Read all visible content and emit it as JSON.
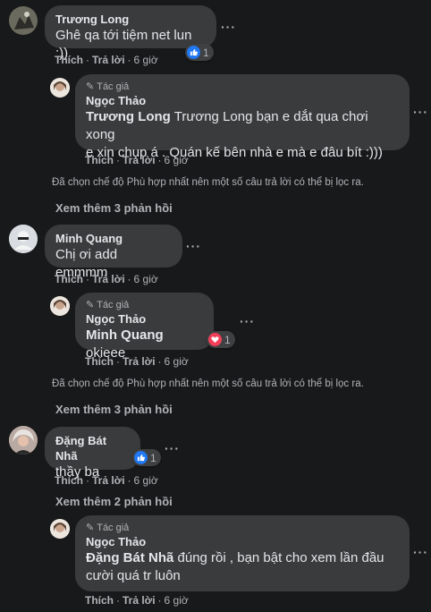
{
  "comments": [
    {
      "author": "Trương Long",
      "text": "Ghê qa tới tiệm net lun :))",
      "reaction_count": "1",
      "actions": {
        "like": "Thích",
        "reply": "Trả lời",
        "time": "6 giờ"
      },
      "reply": {
        "author_tag": "Tác giả",
        "author": "Ngọc Thảo",
        "mention": "Trương Long",
        "text_line1": " Trương Long bạn e dắt qua chơi xong",
        "text_line2": "e xin chụp á . Quán kế bên nhà e mà e đâu bít :)))",
        "actions": {
          "like": "Thích",
          "reply": "Trả lời",
          "time": "6 giờ"
        }
      },
      "filter_note": "Đã chọn chế độ Phù hợp nhất nên một số câu trả lời có thể bị lọc ra.",
      "see_more": "Xem thêm 3 phản hồi"
    },
    {
      "author": "Minh Quang",
      "text": "Chị ơi add emmmm",
      "actions": {
        "like": "Thích",
        "reply": "Trả lời",
        "time": "6 giờ"
      },
      "reply": {
        "author_tag": "Tác giả",
        "author": "Ngọc Thảo",
        "mention": "Minh Quang",
        "text": " okieee",
        "reaction_count": "1",
        "actions": {
          "like": "Thích",
          "reply": "Trả lời",
          "time": "6 giờ"
        }
      },
      "filter_note": "Đã chọn chế độ Phù hợp nhất nên một số câu trả lời có thể bị lọc ra.",
      "see_more": "Xem thêm 3 phản hồi"
    },
    {
      "author": "Đặng Bát Nhã",
      "text": "thầy ba",
      "reaction_count": "1",
      "actions": {
        "like": "Thích",
        "reply": "Trả lời",
        "time": "6 giờ"
      },
      "see_more": "Xem thêm 2 phản hồi",
      "reply": {
        "author_tag": "Tác giả",
        "author": "Ngọc Thảo",
        "mention": "Đặng Bát Nhã",
        "text_line1": " đúng rồi , bạn bật cho xem lần đầu",
        "text_line2": "cười quá tr luôn",
        "actions": {
          "like": "Thích",
          "reply": "Trả lời",
          "time": "6 giờ"
        }
      }
    }
  ],
  "colors": {
    "background": "#18191a",
    "bubble": "#3a3b3c",
    "text": "#e4e6eb",
    "secondary": "#b0b3b8",
    "like_blue": "#2078f4",
    "love_red": "#f33e58"
  }
}
